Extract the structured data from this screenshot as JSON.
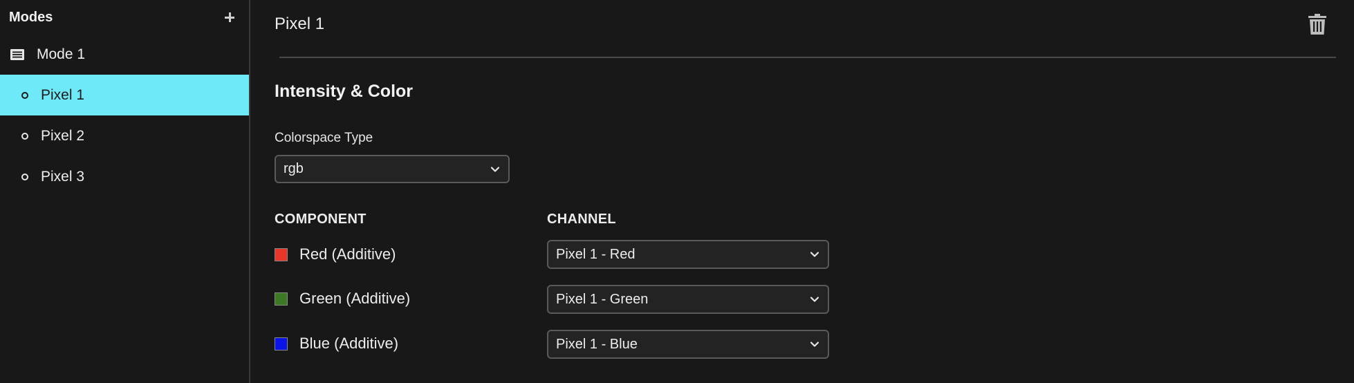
{
  "sidebar": {
    "title": "Modes",
    "add_icon": "plus-icon",
    "mode": {
      "label": "Mode 1",
      "icon": "list-icon"
    },
    "pixels": [
      {
        "label": "Pixel 1",
        "selected": true
      },
      {
        "label": "Pixel 2",
        "selected": false
      },
      {
        "label": "Pixel 3",
        "selected": false
      }
    ],
    "selected_color": "#6ee9f8"
  },
  "main": {
    "title": "Pixel 1",
    "delete_icon": "trash-icon",
    "section_title": "Intensity & Color",
    "colorspace": {
      "label": "Colorspace Type",
      "value": "rgb"
    },
    "table": {
      "component_header": "COMPONENT",
      "channel_header": "CHANNEL",
      "rows": [
        {
          "component": "Red (Additive)",
          "color": "#e8352a",
          "channel": "Pixel 1 - Red"
        },
        {
          "component": "Green (Additive)",
          "color": "#3b7a22",
          "channel": "Pixel 1 - Green"
        },
        {
          "component": "Blue (Additive)",
          "color": "#0b14e6",
          "channel": "Pixel 1 - Blue"
        }
      ]
    }
  }
}
